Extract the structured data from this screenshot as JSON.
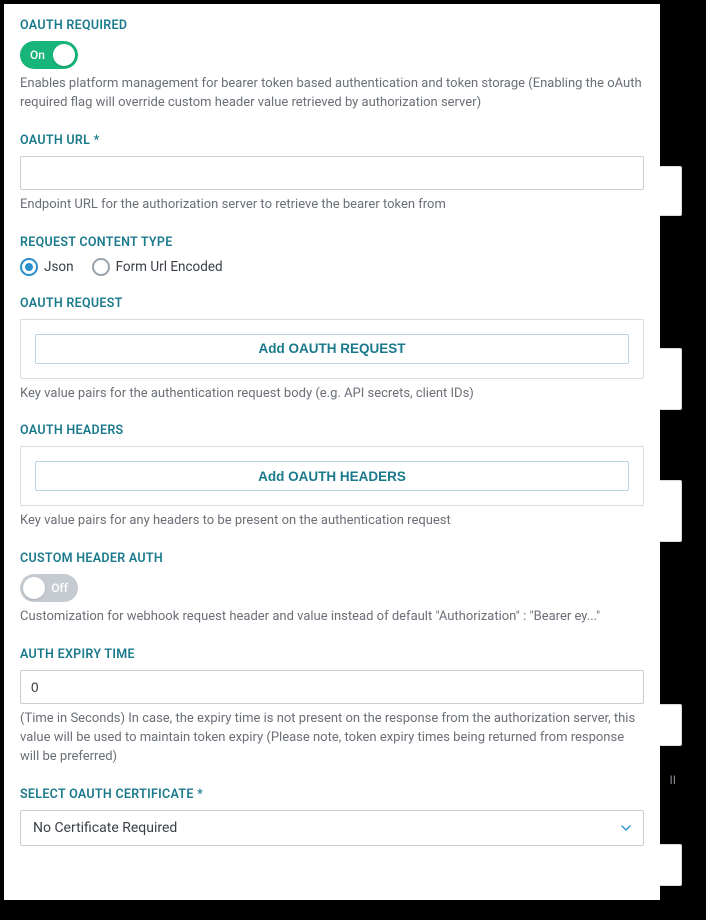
{
  "colors": {
    "accent": "#1a7a8c",
    "toggle_on": "#17b57a",
    "chevron": "#2a8ec9"
  },
  "oauth_required": {
    "label": "OAUTH REQUIRED",
    "toggle_state": "On",
    "help": "Enables platform management for bearer token based authentication and token storage (Enabling the oAuth required flag will override custom header value retrieved by authorization server)"
  },
  "oauth_url": {
    "label": "OAUTH URL *",
    "value": "",
    "help": "Endpoint URL for the authorization server to retrieve the bearer token from"
  },
  "content_type": {
    "label": "REQUEST CONTENT TYPE",
    "options": [
      "Json",
      "Form Url Encoded"
    ],
    "selected": "Json"
  },
  "oauth_request": {
    "label": "OAUTH REQUEST",
    "button": "Add OAUTH REQUEST",
    "help": "Key value pairs for the authentication request body (e.g. API secrets, client IDs)"
  },
  "oauth_headers": {
    "label": "OAUTH HEADERS",
    "button": "Add OAUTH HEADERS",
    "help": "Key value pairs for any headers to be present on the authentication request"
  },
  "custom_header": {
    "label": "CUSTOM HEADER AUTH",
    "toggle_state": "Off",
    "help": "Customization for webhook request header and value instead of default \"Authorization\" : \"Bearer ey...\""
  },
  "expiry": {
    "label": "AUTH EXPIRY TIME",
    "value": "0",
    "help": "(Time in Seconds) In case, the expiry time is not present on the response from the authorization server, this value will be used to maintain token expiry (Please note, token expiry times being returned from response will be preferred)"
  },
  "cert": {
    "label": "SELECT OAUTH CERTIFICATE *",
    "selected": "No Certificate Required"
  }
}
